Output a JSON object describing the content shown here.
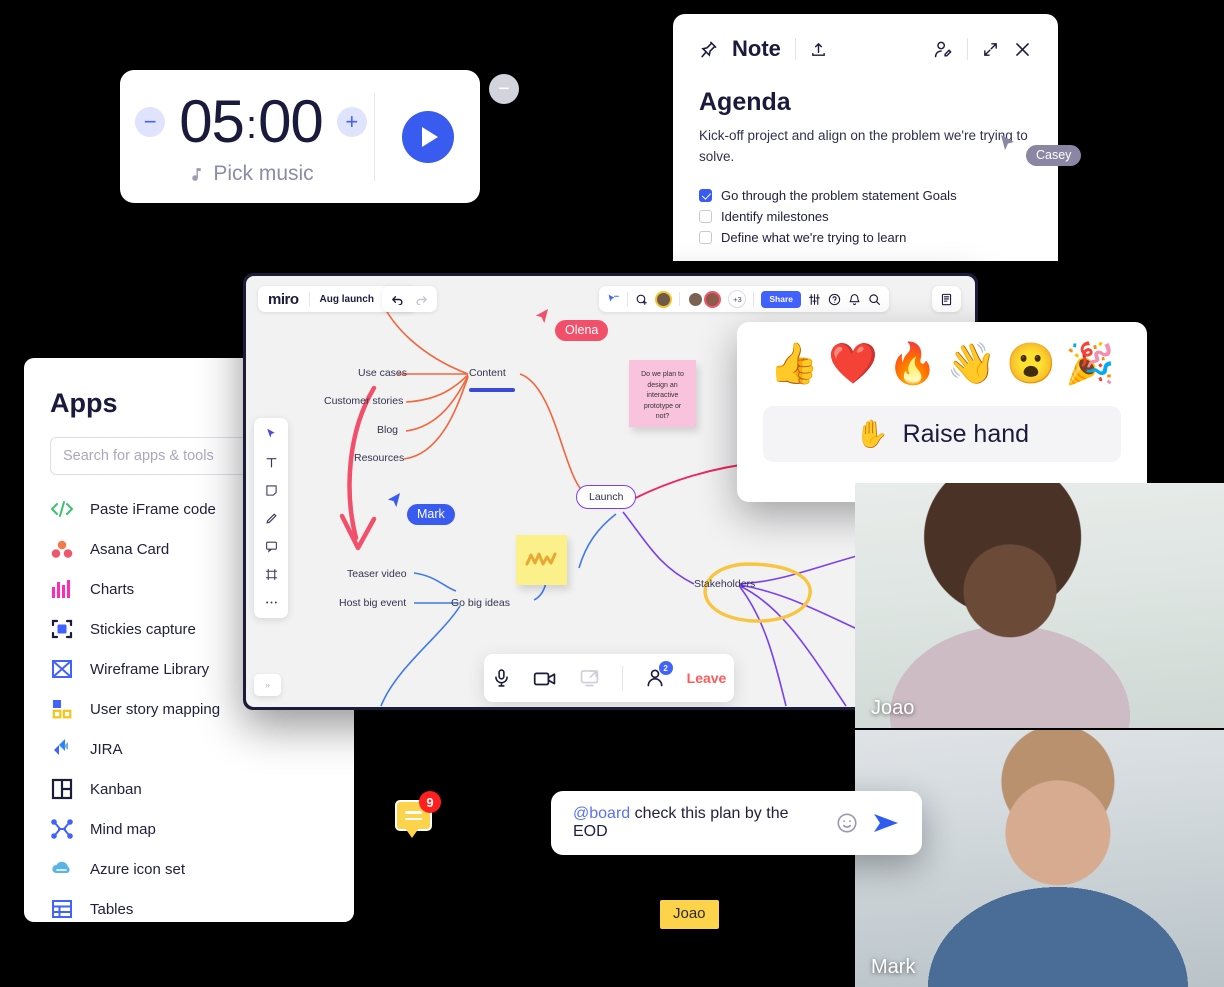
{
  "timer": {
    "minus_label": "−",
    "plus_label": "+",
    "time": "05",
    "colon": ":",
    "seconds": "00",
    "music_icon": "music-note-icon",
    "music_label": "Pick music",
    "play_icon": "play-icon",
    "collapse_label": "−"
  },
  "note": {
    "pin_icon": "pin-icon",
    "title": "Note",
    "upload_icon": "upload-icon",
    "invite_icon": "invite-user-icon",
    "expand_icon": "expand-icon",
    "close_icon": "close-icon",
    "heading": "Agenda",
    "description": "Kick-off project and align on the problem we're trying to solve.",
    "items": [
      {
        "label": "Go through the problem statement Goals",
        "checked": true
      },
      {
        "label": "Identify milestones",
        "checked": false
      },
      {
        "label": "Define what we're trying to learn",
        "checked": false
      }
    ]
  },
  "cursors": {
    "casey": {
      "name": "Casey",
      "color": "#8a86a3"
    },
    "olena": {
      "name": "Olena",
      "color": "#f2506a"
    },
    "mark": {
      "name": "Mark",
      "color": "#3a5bf0"
    },
    "joao": {
      "name": "Joao",
      "color": "#fcd34a"
    }
  },
  "apps": {
    "title": "Apps",
    "search_placeholder": "Search for apps & tools",
    "search_value": "",
    "items": [
      {
        "label": "Paste iFrame code",
        "icon": "code-icon",
        "color": "#3cc16f"
      },
      {
        "label": "Asana Card",
        "icon": "asana-icon",
        "color": "#f06a6a"
      },
      {
        "label": "Charts",
        "icon": "charts-icon",
        "color": "#ff2bb5"
      },
      {
        "label": "Stickies capture",
        "icon": "capture-icon",
        "color": "#1b1b3a"
      },
      {
        "label": "Wireframe Library",
        "icon": "wireframe-icon",
        "color": "#4262ff"
      },
      {
        "label": "User story mapping",
        "icon": "story-map-icon",
        "color": "#4262ff"
      },
      {
        "label": "JIRA",
        "icon": "jira-icon",
        "color": "#4262ff"
      },
      {
        "label": "Kanban",
        "icon": "kanban-icon",
        "color": "#1b1b3a"
      },
      {
        "label": "Mind map",
        "icon": "mindmap-icon",
        "color": "#4262ff"
      },
      {
        "label": "Azure icon set",
        "icon": "azure-icon",
        "color": "#4aa8e0"
      },
      {
        "label": "Tables",
        "icon": "tables-icon",
        "color": "#4262ff"
      }
    ]
  },
  "board": {
    "logo": "miro",
    "name": "Aug launch",
    "upload_icon": "upload-icon",
    "undo_icon": "undo-icon",
    "redo_icon": "redo-icon",
    "cursor_share_icon": "cursor-share-icon",
    "add_collaborator_icon": "add-collaborator-icon",
    "extra_members": "+3",
    "share_label": "Share",
    "settings_icon": "sliders-icon",
    "help_icon": "help-icon",
    "bell_icon": "bell-icon",
    "search_icon": "search-icon",
    "notes_icon": "notes-panel-icon",
    "expand_label": "»",
    "tools": [
      "cursor-icon",
      "text-icon",
      "sticky-note-icon",
      "pen-icon",
      "comment-icon",
      "frame-icon",
      "more-tools-icon"
    ],
    "mindmap": {
      "nodes": [
        {
          "label": "Use cases"
        },
        {
          "label": "Customer stories"
        },
        {
          "label": "Blog"
        },
        {
          "label": "Resources"
        },
        {
          "label": "Content"
        },
        {
          "label": "Launch"
        },
        {
          "label": "Teaser video"
        },
        {
          "label": "Host big event"
        },
        {
          "label": "Go big ideas"
        },
        {
          "label": "Stakeholders"
        }
      ],
      "sticky_pink": "Do we plan to design an interactive prototype or not?",
      "sticky_yellow": ""
    },
    "call": {
      "mic_icon": "microphone-icon",
      "camera_icon": "camera-icon",
      "share_screen_icon": "share-screen-icon",
      "people_icon": "people-icon",
      "people_count": "2",
      "leave_label": "Leave"
    }
  },
  "reactions": {
    "emojis": [
      {
        "glyph": "👍",
        "name": "thumbs-up-emoji"
      },
      {
        "glyph": "❤️",
        "name": "heart-emoji"
      },
      {
        "glyph": "🔥",
        "name": "fire-emoji"
      },
      {
        "glyph": "👋",
        "name": "wave-emoji"
      },
      {
        "glyph": "😮",
        "name": "surprised-emoji"
      },
      {
        "glyph": "🎉",
        "name": "party-popper-emoji"
      }
    ],
    "raise_hand_icon": "✋",
    "raise_hand_label": "Raise hand"
  },
  "participants": [
    {
      "name": "Joao"
    },
    {
      "name": "Mark"
    }
  ],
  "chat": {
    "mention": "@board",
    "message": " check this plan by the EOD",
    "emoji_icon": "emoji-icon",
    "send_icon": "send-icon"
  },
  "comments": {
    "count": "9",
    "icon": "comment-bubble-icon"
  }
}
